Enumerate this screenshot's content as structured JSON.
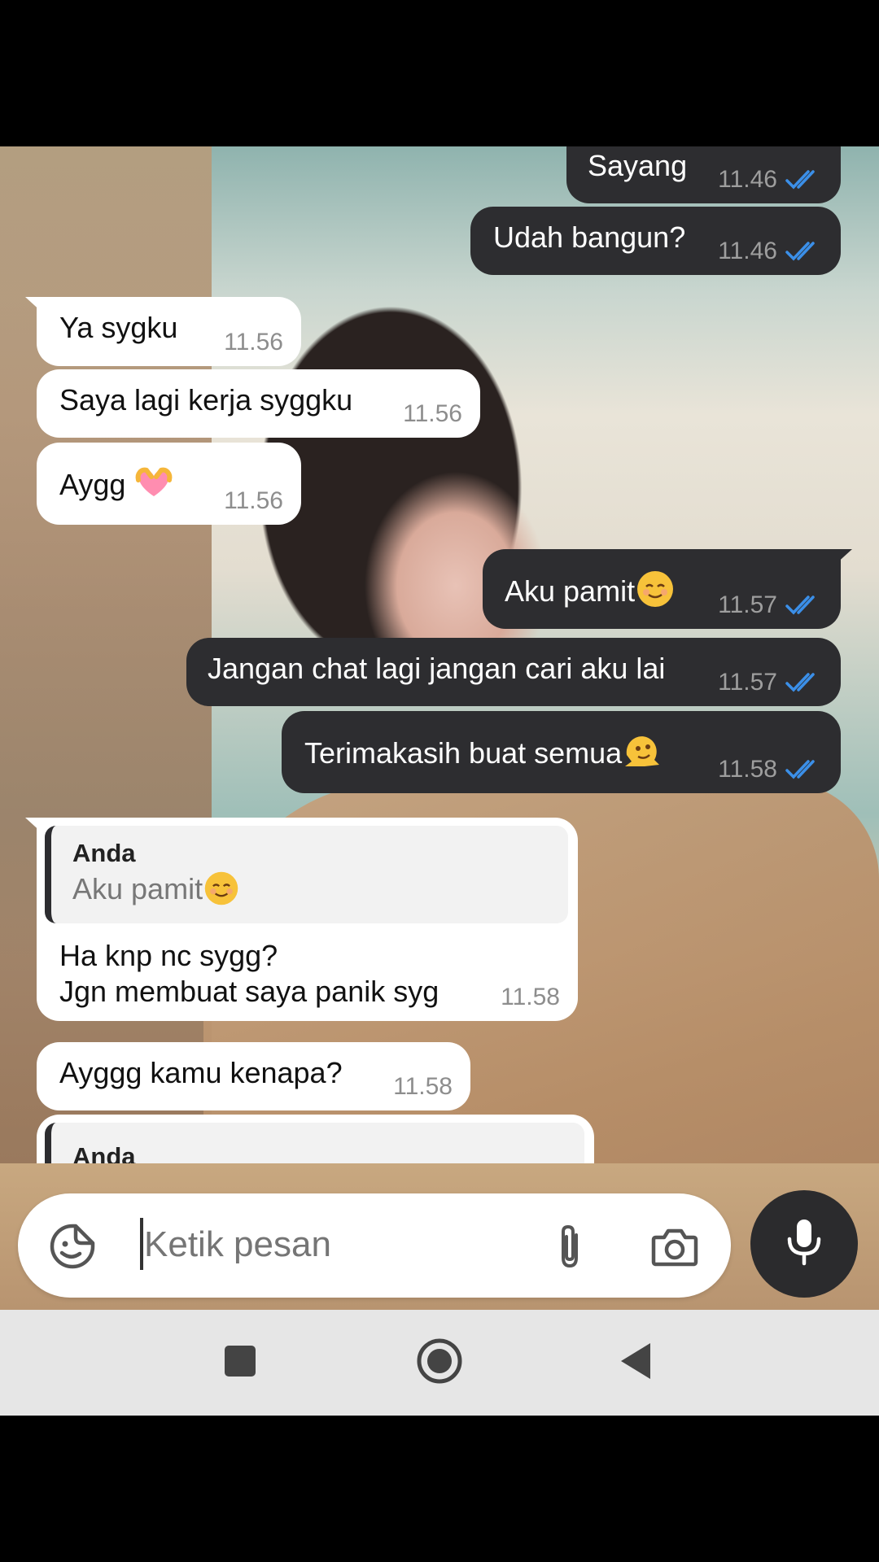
{
  "messages": [
    {
      "dir": "out",
      "text": "Sayang",
      "time": "11.46",
      "status": "read"
    },
    {
      "dir": "out",
      "text": "Udah bangun?",
      "time": "11.46",
      "status": "read"
    },
    {
      "dir": "in",
      "text": "Ya sygku",
      "time": "11.56"
    },
    {
      "dir": "in",
      "text": "Saya lagi kerja syggku",
      "time": "11.56"
    },
    {
      "dir": "in",
      "text": "Aygg",
      "emoji": "heart-hands-emoji",
      "time": "11.56"
    },
    {
      "dir": "out",
      "text": "Aku pamit",
      "emoji": "relieved-face-emoji",
      "time": "11.57",
      "status": "read"
    },
    {
      "dir": "out",
      "text": "Jangan chat lagi jangan cari aku lai",
      "time": "11.57",
      "status": "read"
    },
    {
      "dir": "out",
      "text": "Terimakasih buat semua",
      "emoji": "melting-face-emoji",
      "time": "11.58",
      "status": "read"
    },
    {
      "dir": "in",
      "quote_author": "Anda",
      "quote_text": "Aku pamit",
      "quote_emoji": "relieved-face-emoji",
      "line1": "Ha knp nc sygg?",
      "line2": "Jgn membuat saya panik syg",
      "time": "11.58"
    },
    {
      "dir": "in",
      "text": "Ayggg kamu kenapa?",
      "time": "11.58"
    },
    {
      "dir": "in",
      "quote_author": "Anda"
    }
  ],
  "composer": {
    "placeholder": "Ketik pesan",
    "icons": [
      "sticker-icon",
      "attach-icon",
      "camera-icon",
      "mic-icon"
    ]
  },
  "scroll_button_icon": "double-chevron-down-icon",
  "navbar": {
    "icons": [
      "recents-square-icon",
      "home-circle-icon",
      "back-triangle-icon"
    ]
  },
  "colors": {
    "outgoing_bubble": "#2d2d30",
    "incoming_bubble": "#ffffff",
    "read_tick": "#3b8fe8"
  }
}
